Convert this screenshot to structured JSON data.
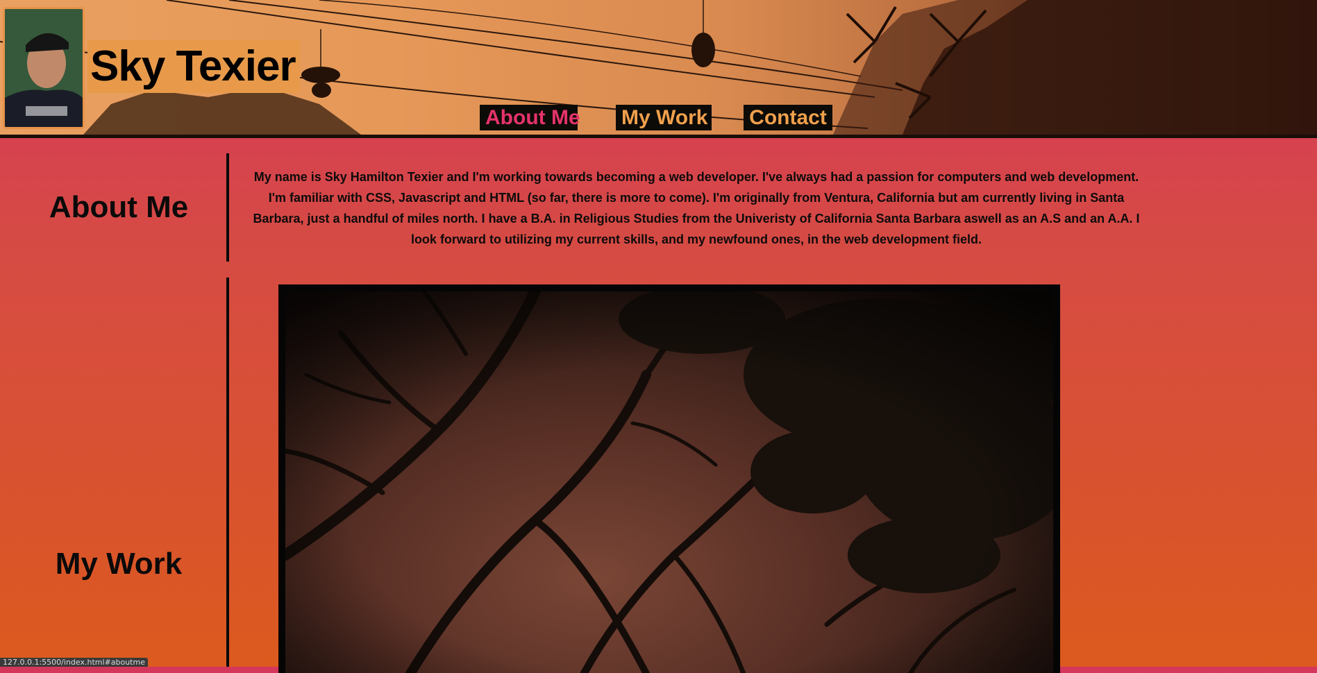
{
  "header": {
    "site_title": "Sky Texier"
  },
  "nav": {
    "items": [
      {
        "label": "About Me",
        "active": true
      },
      {
        "label": "My Work",
        "active": false
      },
      {
        "label": "Contact",
        "active": false
      }
    ]
  },
  "about": {
    "heading": "About Me",
    "body": "My name is Sky Hamilton Texier and I'm working towards becoming a web developer. I've always had a passion for computers and web development. I'm familiar with CSS, Javascript and HTML (so far, there is more to come). I'm originally from Ventura, California but am currently living in Santa Barbara, just a handful of miles north. I have a B.A. in Religious Studies from the Univeristy of California Santa Barbara aswell as an A.S and an A.A. I look forward to utilizing my current skills, and my newfound ones, in the web development field."
  },
  "work": {
    "heading": "My Work"
  },
  "status_bar": {
    "url": "127.0.0.1:5500/index.html#aboutme"
  },
  "colors": {
    "page_top": "#d5365c",
    "page_bottom": "#dc5a1e",
    "nav_active": "#e6336a",
    "nav_inactive": "#f0a04c",
    "title_bg": "#e89a4a"
  }
}
